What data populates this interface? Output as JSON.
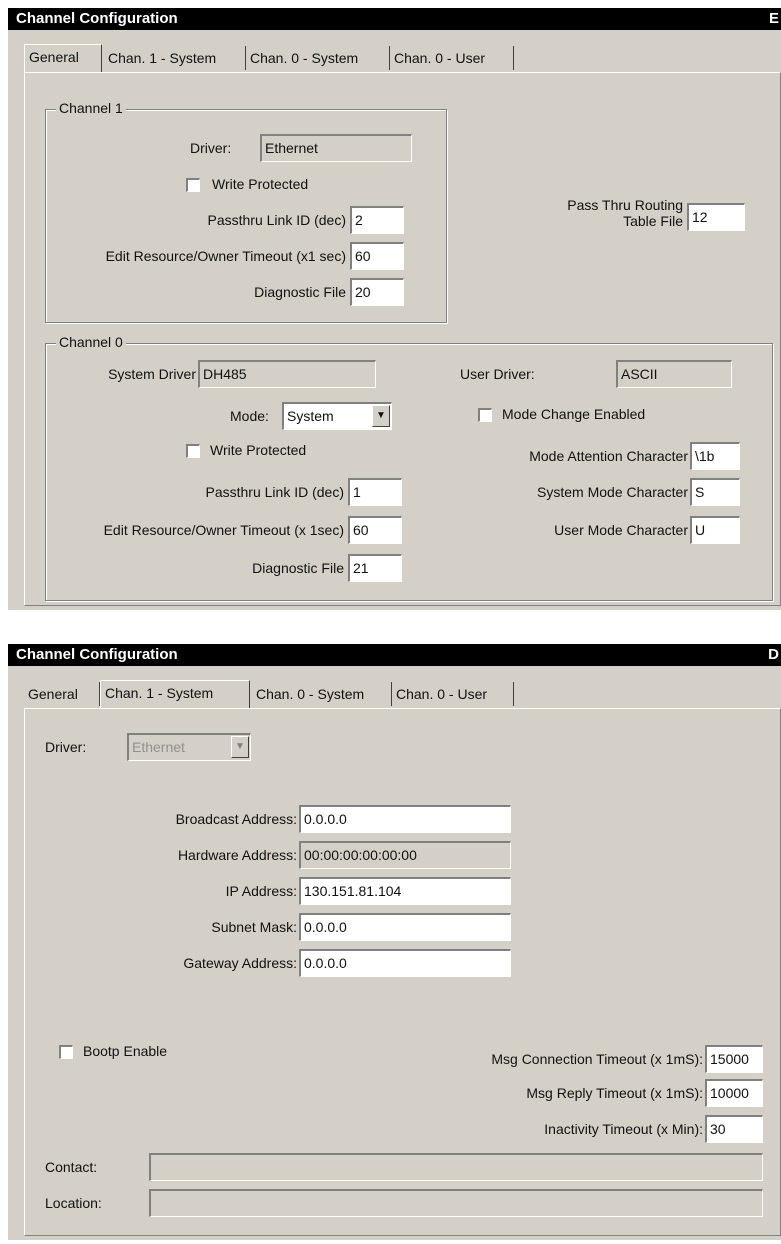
{
  "top": {
    "title": "Channel Configuration",
    "title_right": "E",
    "tabs": [
      "General",
      "Chan. 1 - System",
      "Chan. 0 - System",
      "Chan. 0 - User"
    ],
    "channel1": {
      "legend": "Channel 1",
      "driver_label": "Driver:",
      "driver_value": "Ethernet",
      "write_protected_label": "Write Protected",
      "passthru_label": "Passthru Link ID (dec)",
      "passthru_value": "2",
      "edit_timeout_label": "Edit Resource/Owner Timeout (x1 sec)",
      "edit_timeout_value": "60",
      "diag_label": "Diagnostic File",
      "diag_value": "20"
    },
    "pass_thru": {
      "label_line1": "Pass Thru Routing",
      "label_line2": "Table File",
      "value": "12"
    },
    "channel0": {
      "legend": "Channel 0",
      "system_driver_label": "System Driver",
      "system_driver_value": "DH485",
      "user_driver_label": "User Driver:",
      "user_driver_value": "ASCII",
      "mode_label": "Mode:",
      "mode_value": "System",
      "mode_change_label": "Mode Change Enabled",
      "write_protected_label": "Write Protected",
      "mode_attention_label": "Mode Attention Character",
      "mode_attention_value": "\\1b",
      "passthru_label": "Passthru Link ID (dec)",
      "passthru_value": "1",
      "system_mode_char_label": "System Mode Character",
      "system_mode_char_value": "S",
      "edit_timeout_label": "Edit Resource/Owner Timeout (x 1sec)",
      "edit_timeout_value": "60",
      "user_mode_char_label": "User Mode Character",
      "user_mode_char_value": "U",
      "diag_label": "Diagnostic File",
      "diag_value": "21"
    }
  },
  "bottom": {
    "title": "Channel Configuration",
    "title_right": "D",
    "tabs": [
      "General",
      "Chan. 1 - System",
      "Chan. 0 - System",
      "Chan. 0 - User"
    ],
    "driver_label": "Driver:",
    "driver_value": "Ethernet",
    "broadcast_label": "Broadcast Address:",
    "broadcast_value": "0.0.0.0",
    "hardware_label": "Hardware Address:",
    "hardware_value": "00:00:00:00:00:00",
    "ip_label": "IP Address:",
    "ip_value": "130.151.81.104",
    "subnet_label": "Subnet Mask:",
    "subnet_value": "0.0.0.0",
    "gateway_label": "Gateway Address:",
    "gateway_value": "0.0.0.0",
    "bootp_label": "Bootp Enable",
    "msg_conn_label": "Msg Connection Timeout (x 1mS):",
    "msg_conn_value": "15000",
    "msg_reply_label": "Msg Reply Timeout (x 1mS):",
    "msg_reply_value": "10000",
    "inactivity_label": "Inactivity Timeout (x Min):",
    "inactivity_value": "30",
    "contact_label": "Contact:",
    "contact_value": "",
    "location_label": "Location:",
    "location_value": ""
  }
}
